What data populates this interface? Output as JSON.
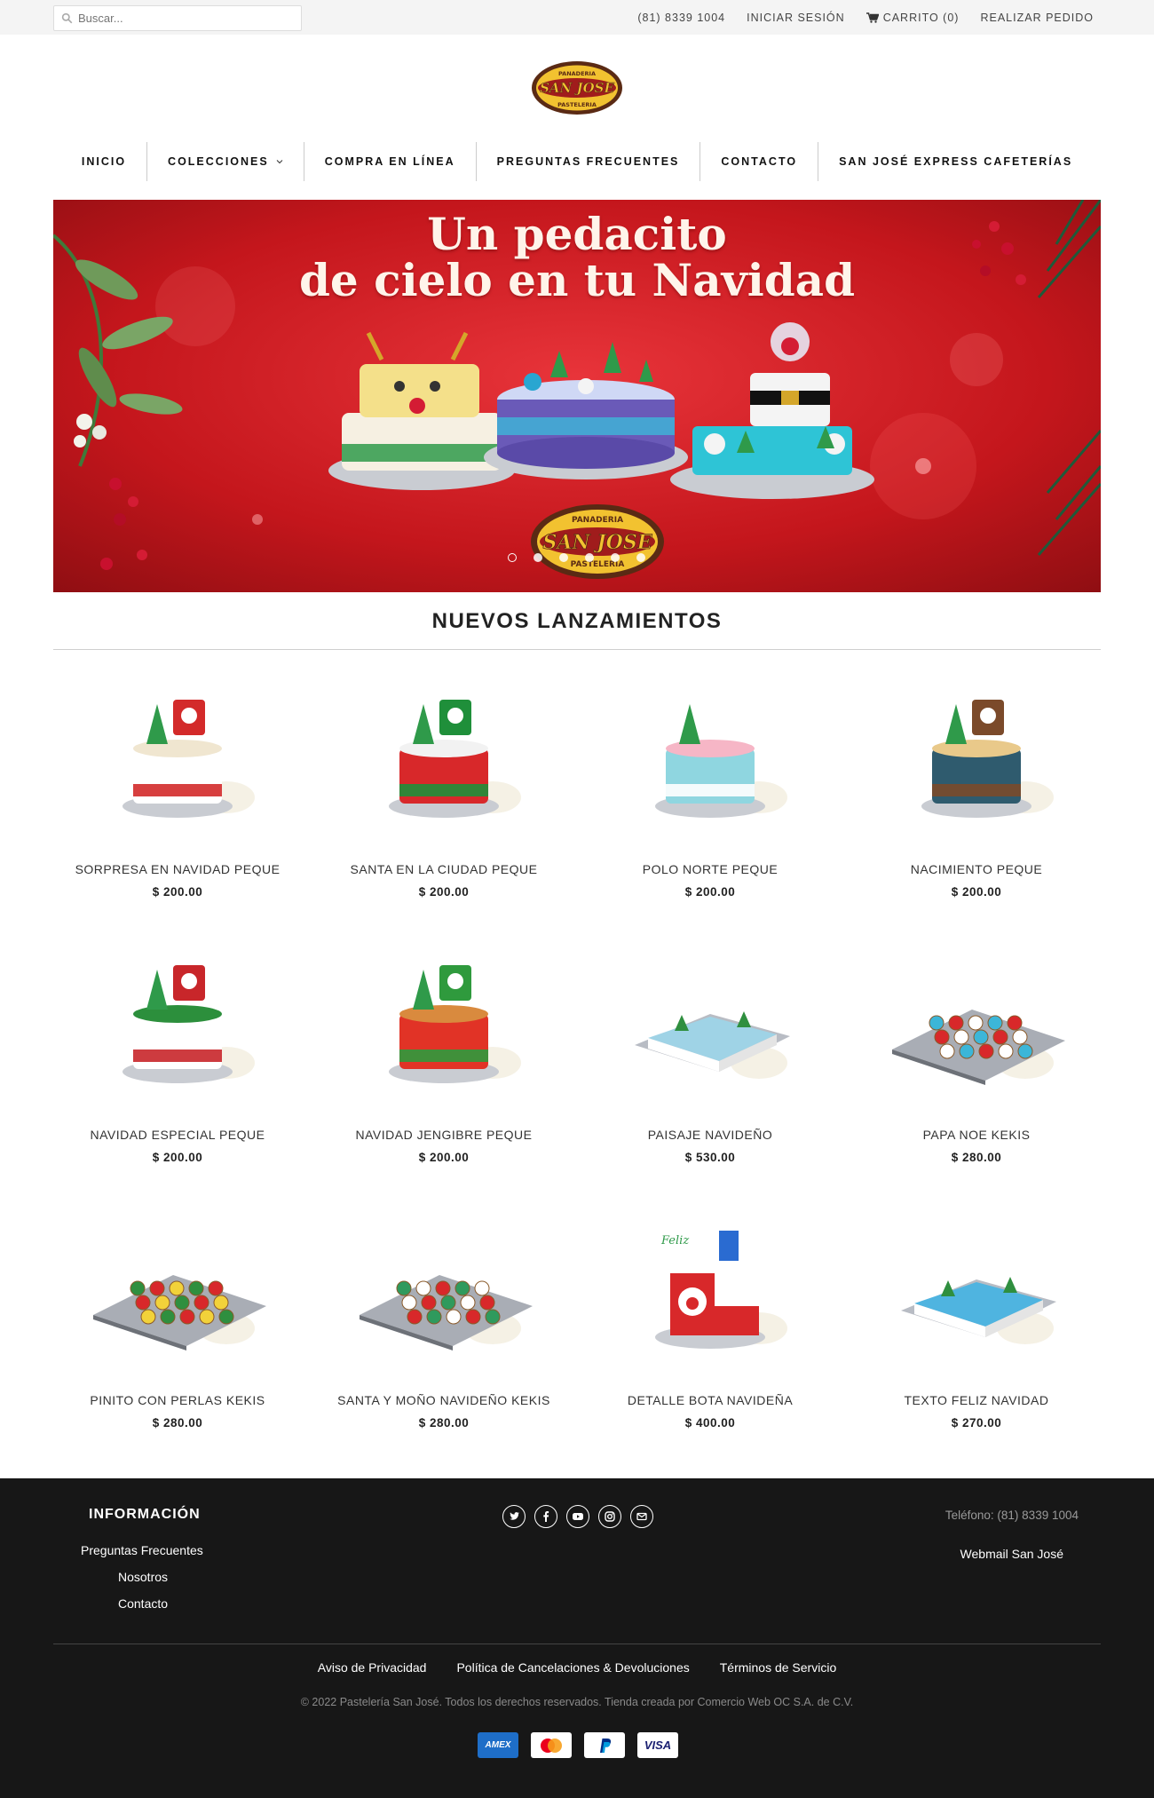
{
  "topbar": {
    "search_placeholder": "Buscar...",
    "phone": "(81) 8339 1004",
    "login": "INICIAR SESIÓN",
    "cart": "CARRITO (0)",
    "checkout": "REALIZAR PEDIDO"
  },
  "logo": {
    "top": "PANADERIA",
    "main": "SAN JOSE",
    "bottom": "PASTELERIA"
  },
  "nav": {
    "items": [
      "INICIO",
      "COLECCIONES",
      "COMPRA EN LÍNEA",
      "PREGUNTAS FRECUENTES",
      "CONTACTO",
      "SAN JOSÉ EXPRESS CAFETERÍAS"
    ]
  },
  "banner": {
    "line1": "Un pedacito",
    "line2": "de cielo en tu Navidad",
    "logo_main": "SAN JOSE",
    "logo_top": "PANADERIA",
    "logo_bottom": "PASTELERIA"
  },
  "section": {
    "title": "NUEVOS LANZAMIENTOS"
  },
  "products": [
    {
      "name": "SORPRESA EN NAVIDAD PEQUE",
      "price": "$ 200.00",
      "shape": "round",
      "colors": [
        "#ffffff",
        "#d32a2a",
        "#f0e6d0"
      ]
    },
    {
      "name": "SANTA EN LA CIUDAD PEQUE",
      "price": "$ 200.00",
      "shape": "round",
      "colors": [
        "#d8282a",
        "#1f8f3a",
        "#f2f2f2"
      ]
    },
    {
      "name": "POLO NORTE PEQUE",
      "price": "$ 200.00",
      "shape": "round",
      "colors": [
        "#8fd6e0",
        "#ffffff",
        "#f6b6c6"
      ]
    },
    {
      "name": "NACIMIENTO PEQUE",
      "price": "$ 200.00",
      "shape": "round",
      "colors": [
        "#2f5b6e",
        "#7b4a2a",
        "#e9c98a"
      ]
    },
    {
      "name": "NAVIDAD ESPECIAL PEQUE",
      "price": "$ 200.00",
      "shape": "round",
      "colors": [
        "#ffffff",
        "#c8262a",
        "#2c8f3c"
      ]
    },
    {
      "name": "NAVIDAD JENGIBRE PEQUE",
      "price": "$ 200.00",
      "shape": "round",
      "colors": [
        "#e13326",
        "#2f9a3d",
        "#d98a3e"
      ]
    },
    {
      "name": "PAISAJE NAVIDEÑO",
      "price": "$ 530.00",
      "shape": "sheet",
      "colors": [
        "#9fd3e6",
        "#ffffff",
        "#2f8f3f"
      ]
    },
    {
      "name": "PAPA NOE KEKIS",
      "price": "$ 280.00",
      "shape": "cupcakes",
      "colors": [
        "#3cb6d8",
        "#d8282a",
        "#ffffff"
      ]
    },
    {
      "name": "PINITO CON PERLAS KEKIS",
      "price": "$ 280.00",
      "shape": "cupcakes",
      "colors": [
        "#2f8f3f",
        "#d8282a",
        "#f2d23a"
      ]
    },
    {
      "name": "SANTA Y MOÑO NAVIDEÑO KEKIS",
      "price": "$ 280.00",
      "shape": "cupcakes",
      "colors": [
        "#2f9a5d",
        "#ffffff",
        "#d8282a"
      ]
    },
    {
      "name": "DETALLE BOTA NAVIDEÑA",
      "price": "$ 400.00",
      "shape": "boot",
      "colors": [
        "#d8282a",
        "#ffffff",
        "#2a6bd1"
      ]
    },
    {
      "name": "TEXTO FELIZ NAVIDAD",
      "price": "$ 270.00",
      "shape": "sheet",
      "colors": [
        "#4fb4e0",
        "#ffffff",
        "#2f8f3f"
      ]
    }
  ],
  "footer": {
    "info_title": "INFORMACIÓN",
    "links": [
      "Preguntas Frecuentes",
      "Nosotros",
      "Contacto"
    ],
    "phone": "Teléfono: (81) 8339 1004",
    "webmail": "Webmail San José",
    "legal": [
      "Aviso de Privacidad",
      "Política de Cancelaciones & Devoluciones",
      "Términos de Servicio"
    ],
    "copyright": "© 2022 Pastelería San José. Todos los derechos reservados. Tienda creada por Comercio Web OC S.A. de C.V.",
    "socials": [
      "twitter-icon",
      "facebook-icon",
      "youtube-icon",
      "instagram-icon",
      "email-icon"
    ],
    "payments": [
      "AMEX",
      "mastercard",
      "PayPal",
      "VISA"
    ]
  },
  "colors": {
    "banner_red": "#c4161c",
    "logo_brown": "#5a2a14",
    "logo_gold": "#f2c230",
    "footer_bg": "#171717"
  }
}
